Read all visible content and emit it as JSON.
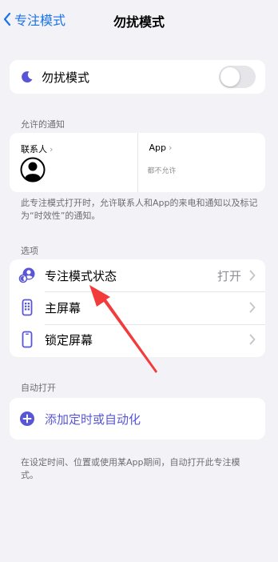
{
  "nav": {
    "back_label": "专注模式",
    "title": "勿扰模式"
  },
  "dnd": {
    "label": "勿扰模式",
    "enabled": false
  },
  "allowed": {
    "section_label": "允许的通知",
    "people": {
      "title": "联系人"
    },
    "apps": {
      "title": "App",
      "subtitle": "都不允许"
    },
    "footnote": "此专注模式打开时，允许联系人和App的来电和通知以及标记为“时效性”的通知。"
  },
  "options": {
    "section_label": "选项",
    "items": [
      {
        "label": "专注模式状态",
        "value": "打开",
        "icon": "focus-status-icon"
      },
      {
        "label": "主屏幕",
        "value": "",
        "icon": "home-screen-icon"
      },
      {
        "label": "锁定屏幕",
        "value": "",
        "icon": "lock-screen-icon"
      }
    ]
  },
  "auto": {
    "section_label": "自动打开",
    "add_label": "添加定时或自动化",
    "footnote": "在设定时间、位置或使用某App期间，自动打开此专注模式。"
  },
  "colors": {
    "accent": "#5856d6",
    "link": "#1a73e8",
    "annotation": "#f23b3b"
  }
}
